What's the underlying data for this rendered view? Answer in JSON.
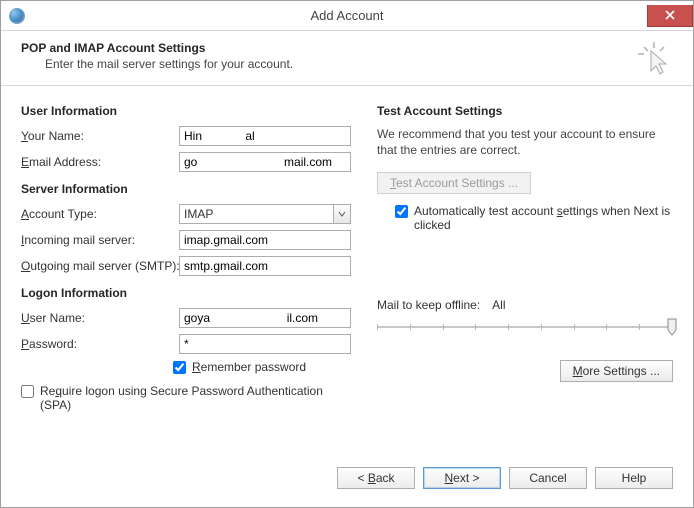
{
  "window": {
    "title": "Add Account"
  },
  "header": {
    "title": "POP and IMAP Account Settings",
    "subtitle": "Enter the mail server settings for your account."
  },
  "left": {
    "user_info_head": "User Information",
    "your_name_label_pre": "Y",
    "your_name_label_rest": "our Name:",
    "your_name_value": "Hin             al",
    "email_label_pre": "E",
    "email_label_rest": "mail Address:",
    "email_value": "go                          mail.com",
    "server_info_head": "Server Information",
    "account_type_label_pre": "A",
    "account_type_label_rest": "ccount Type:",
    "account_type_value": "IMAP",
    "incoming_label_pre": "I",
    "incoming_label_rest": "ncoming mail server:",
    "incoming_value": "imap.gmail.com",
    "outgoing_label_pre": "O",
    "outgoing_label_rest": "utgoing mail server (SMTP):",
    "outgoing_value": "smtp.gmail.com",
    "logon_info_head": "Logon Information",
    "user_name_label_pre": "U",
    "user_name_label_rest": "ser Name:",
    "user_name_value": "goya                       il.com",
    "password_label_pre": "P",
    "password_label_rest": "assword:",
    "password_value": "*",
    "remember_pre": "R",
    "remember_rest": "emember password",
    "spa_pre": "Re",
    "spa_mid": "q",
    "spa_rest": "uire logon using Secure Password Authentication (SPA)"
  },
  "right": {
    "test_head": "Test Account Settings",
    "test_desc": "We recommend that you test your account to ensure that the entries are correct.",
    "test_btn_pre": "T",
    "test_btn_rest": "est Account Settings ...",
    "auto_pre": "Automatically test account ",
    "auto_mid": "s",
    "auto_rest": "ettings when Next is clicked",
    "mail_keep_label": "Mail to keep offline:",
    "mail_keep_value": "All",
    "more_pre": "M",
    "more_rest": "ore Settings ..."
  },
  "footer": {
    "back_pre": "< ",
    "back_mid": "B",
    "back_rest": "ack",
    "next_pre": "N",
    "next_rest": "ext >",
    "cancel": "Cancel",
    "help": "Help"
  }
}
